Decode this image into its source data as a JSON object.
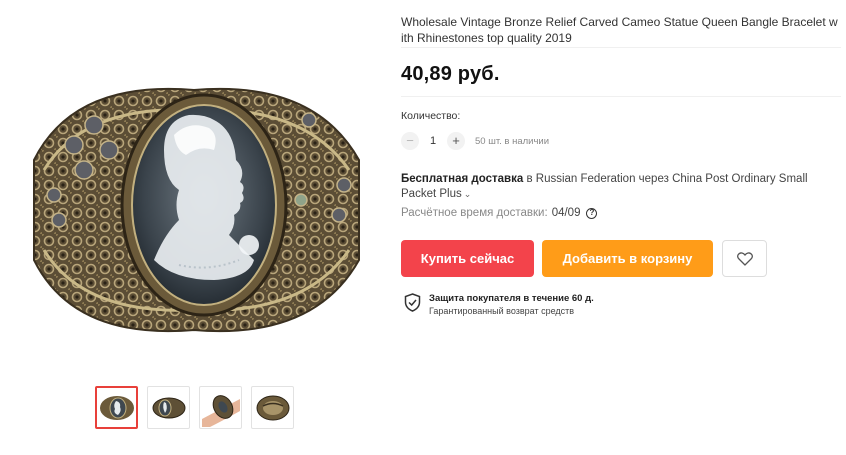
{
  "product": {
    "title": "Wholesale Vintage Bronze Relief Carved Cameo Statue Queen Bangle Bracelet with Rhinestones top quality 2019",
    "price": "40,89 руб."
  },
  "gallery": {
    "main_image": "cameo-bracelet-image",
    "thumbnails": [
      {
        "icon": "cameo-bracelet-front"
      },
      {
        "icon": "cameo-bracelet-side"
      },
      {
        "icon": "cameo-bracelet-on-wrist"
      },
      {
        "icon": "cameo-bracelet-back"
      }
    ],
    "selected_index": 0
  },
  "quantity": {
    "label": "Количество:",
    "minus": "−",
    "value": "1",
    "plus": "+",
    "stock": "50 шт. в наличии"
  },
  "delivery": {
    "free_label": "Бесплатная доставка",
    "text": "в Russian Federation через China Post Ordinary Small Packet Plus",
    "eta_label": "Расчётное время доставки:",
    "eta_date": "04/09",
    "help": "?"
  },
  "actions": {
    "buy_now": "Купить сейчас",
    "add_to_cart": "Добавить в корзину",
    "wishlist_icon": "heart-icon"
  },
  "protection": {
    "title": "Защита покупателя в течение 60 д.",
    "subtitle": "Гарантированный возврат средств"
  },
  "colors": {
    "buy": "#f3434b",
    "cart": "#ff9c18",
    "thumb_active": "#e8403a"
  }
}
